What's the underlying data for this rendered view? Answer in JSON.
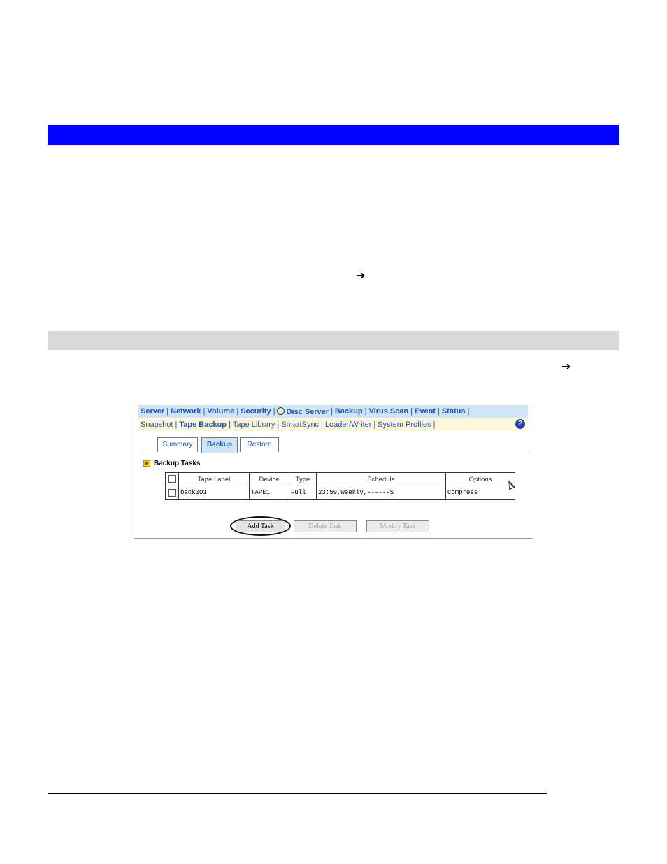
{
  "page": {
    "arrow_glyph_1": "➔",
    "arrow_glyph_2": "➔"
  },
  "colors": {
    "header_bar": "#0000ff",
    "section_bar": "#d9d9d9",
    "nav_bg": "#cfe4f5",
    "subnav_bg": "#fff8d8",
    "link": "#1c55b8"
  },
  "main_nav": {
    "items": [
      "Server",
      "Network",
      "Volume",
      "Security",
      "Disc Server",
      "Backup",
      "Virus Scan",
      "Event",
      "Status"
    ],
    "sep": "|"
  },
  "sub_nav": {
    "items": [
      "Snapshot",
      "Tape Backup",
      "Tape Library",
      "SmartSync",
      "Loader/Writer",
      "System Profiles"
    ],
    "sep": "|",
    "help": "?"
  },
  "tabs": [
    "Summary",
    "Backup",
    "Restore"
  ],
  "section": {
    "title": "Backup Tasks",
    "icon": "arrow-right-icon"
  },
  "table": {
    "headers": [
      "Tape Label",
      "Device",
      "Type",
      "Schedule",
      "Options"
    ],
    "rows": [
      [
        "back001",
        "TAPE1",
        "Full",
        "23:59,weekly,------S",
        "Compress"
      ]
    ]
  },
  "buttons": {
    "add": "Add Task",
    "delete": "Delete Task",
    "modify": "Modify Task"
  }
}
